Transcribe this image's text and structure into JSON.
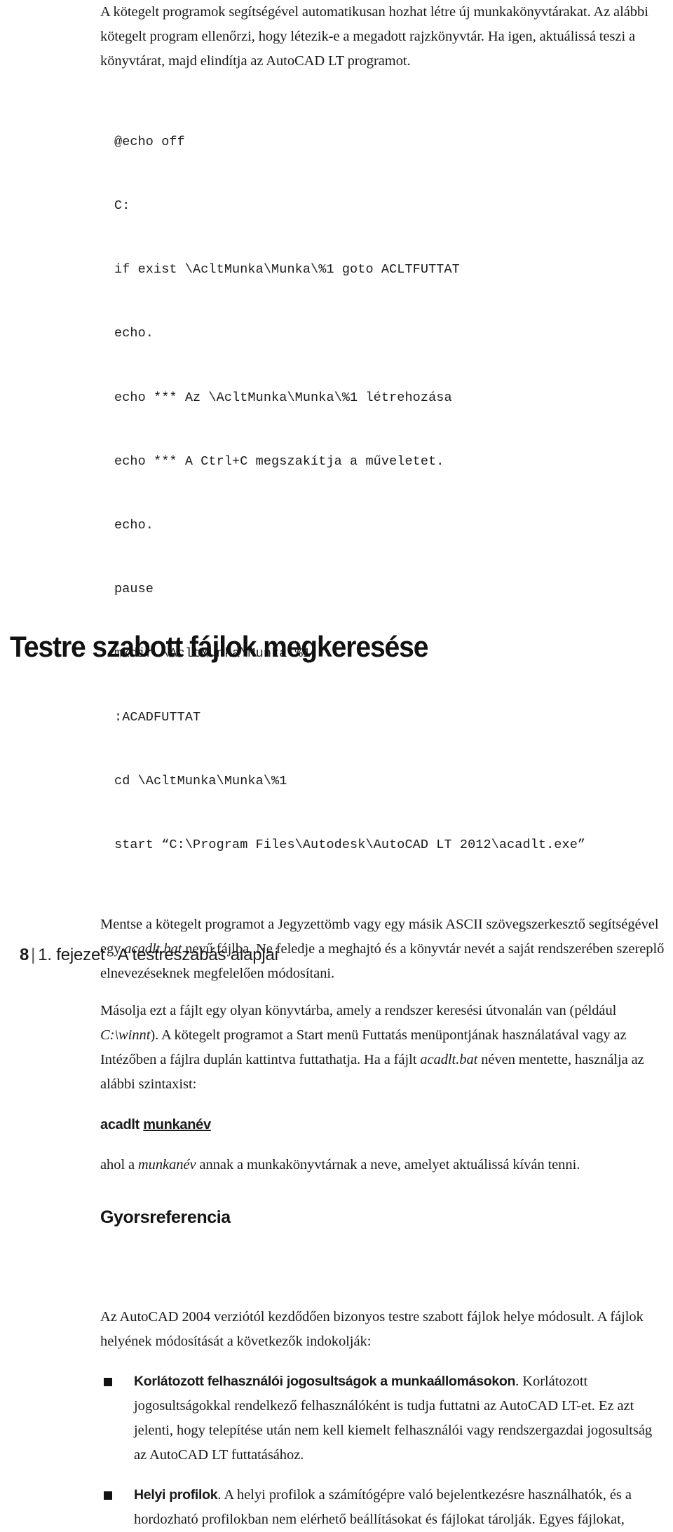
{
  "document": {
    "intro_paragraph": "A kötegelt programok segítségével automatikusan hozhat létre új munkakönyvtárakat. Az alábbi kötegelt program ellenőrzi, hogy létezik-e a megadott rajzkönyvtár. Ha igen, aktuálissá teszi a könyvtárat, majd elindítja az AutoCAD LT programot.",
    "code_block": {
      "name": "batch-program-listing",
      "lines": [
        "@echo off",
        "C:",
        "if exist \\AcltMunka\\Munka\\%1 goto ACLTFUTTAT",
        "echo.",
        "echo *** Az \\AcltMunka\\Munka\\%1 létrehozása",
        "echo *** A Ctrl+C megszakítja a műveletet.",
        "echo.",
        "pause",
        "mkdir \\AcltMunka\\Munka\\%1",
        ":ACADFUTTAT",
        "cd \\AcltMunka\\Munka\\%1",
        "start “C:\\Program Files\\Autodesk\\AutoCAD LT 2012\\acadlt.exe”"
      ]
    },
    "paragraph_save": {
      "part1": "Mentse a kötegelt programot a Jegyzettömb vagy egy másik ASCII szövegszerkesztő segítségével egy ",
      "italic1": "acadlt.bat",
      "part2": " nevű fájlba. Ne feledje a meghajtó és a könyvtár nevét a saját rendszerében szereplő elnevezéseknek megfelelően módosítani."
    },
    "paragraph_copy": {
      "part1": "Másolja ezt a fájlt egy olyan könyvtárba, amely a rendszer keresési útvonalán van (például ",
      "italic1": "C:\\winnt",
      "part2": "). A kötegelt programot a Start menü Futtatás menüpontjának használatával vagy az Intézőben a fájlra duplán kattintva futtathatja. Ha a fájlt ",
      "italic2": "acadlt.bat",
      "part3": " néven mentette, használja az alábbi szintaxist:"
    },
    "syntax_line": {
      "command": "acadlt ",
      "argument": "munkanév"
    },
    "paragraph_where": {
      "part1": "ahol a ",
      "italic1": "munkanév",
      "part2": " annak a munkakönyvtárnak a neve, amelyet aktuálissá kíván tenni."
    },
    "quick_reference_heading": "Gyorsreferencia",
    "section_title": "Testre szabott fájlok megkeresése",
    "paragraph_section_intro": "Az AutoCAD 2004 verziótól kezdődően bizonyos testre szabott fájlok helye módosult. A fájlok helyének módosítását a következők indokolják:",
    "bullets": [
      {
        "lead": "Korlátozott felhasználói jogosultságok a munkaállomásokon",
        "text": ". Korlátozott jogosultságokkal rendelkező felhasználóként is tudja futtatni az AutoCAD LT-et. Ez azt jelenti, hogy telepítése után nem kell kiemelt felhasználói vagy rendszergazdai jogosultság az AutoCAD LT futtatásához."
      },
      {
        "lead": "Helyi profilok",
        "text": ". A helyi profilok a számítógépre való bejelentkezésre használhatók, és a hordozható profilokban nem elérhető beállításokat és fájlokat tárolják. Egyes fájlokat,"
      }
    ],
    "footer": {
      "page_number": "8",
      "separator": "|",
      "chapter": "1. fejezet",
      "chapter_title": "A testreszabás alapjai"
    }
  }
}
